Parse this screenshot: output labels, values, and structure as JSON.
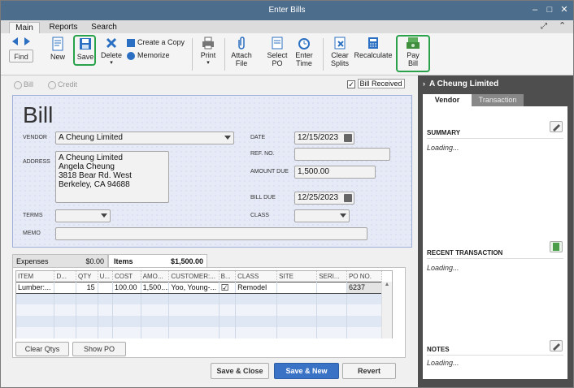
{
  "window": {
    "title": "Enter Bills"
  },
  "tabs": [
    "Main",
    "Reports",
    "Search"
  ],
  "toolbar": {
    "find": "Find",
    "new": "New",
    "save": "Save",
    "delete": "Delete",
    "create_copy": "Create a Copy",
    "memorize": "Memorize",
    "print": "Print",
    "attach_file": [
      "Attach",
      "File"
    ],
    "select_po": [
      "Select",
      "PO"
    ],
    "enter_time": [
      "Enter",
      "Time"
    ],
    "clear_splits": [
      "Clear",
      "Splits"
    ],
    "recalculate": "Recalculate",
    "pay_bill": [
      "Pay",
      "Bill"
    ]
  },
  "type_options": {
    "bill": "Bill",
    "credit": "Credit",
    "bill_received": "Bill Received",
    "bill_received_checked": true
  },
  "form": {
    "heading": "Bill",
    "vendor_label": "VENDOR",
    "vendor": "A Cheung Limited",
    "address_label": "ADDRESS",
    "address": [
      "A Cheung Limited",
      "Angela Cheung",
      "3818 Bear Rd. West",
      "Berkeley, CA 94688"
    ],
    "date_label": "DATE",
    "date": "12/15/2023",
    "ref_label": "REF. NO.",
    "ref": "",
    "amount_due_label": "AMOUNT DUE",
    "amount_due": "1,500.00",
    "bill_due_label": "BILL DUE",
    "bill_due": "12/25/2023",
    "terms_label": "TERMS",
    "terms": "",
    "class_label": "CLASS",
    "class": "",
    "memo_label": "MEMO",
    "memo": ""
  },
  "grid_tabs": {
    "expenses_label": "Expenses",
    "expenses_amount": "$0.00",
    "items_label": "Items",
    "items_amount": "$1,500.00"
  },
  "items_table": {
    "headers": [
      "ITEM",
      "D...",
      "QTY",
      "U...",
      "COST",
      "AMO...",
      "CUSTOMER:...",
      "B...",
      "CLASS",
      "SITE",
      "SERI...",
      "PO NO."
    ],
    "rows": [
      {
        "item": "Lumber:...",
        "desc": "",
        "qty": "15",
        "um": "",
        "cost": "100.00",
        "amount": "1,500....",
        "customer": "Yoo, Young-...",
        "billable": "☑",
        "class": "Remodel",
        "site": "",
        "serial": "",
        "po": "6237"
      }
    ]
  },
  "grid_buttons": {
    "clear_qtys": "Clear Qtys",
    "show_po": "Show PO"
  },
  "footer_buttons": {
    "save_close": "Save & Close",
    "save_new": "Save & New",
    "revert": "Revert"
  },
  "right_panel": {
    "title": "A Cheung Limited",
    "tabs": [
      "Vendor",
      "Transaction"
    ],
    "summary": "SUMMARY",
    "summary_status": "Loading...",
    "recent": "RECENT TRANSACTION",
    "recent_status": "Loading...",
    "notes": "NOTES",
    "notes_status": "Loading..."
  },
  "colors": {
    "titlebar": "#4c6d8c",
    "highlight": "#2aa14b",
    "primary_button": "#3a72c6",
    "panel": "#4e4e4e"
  }
}
